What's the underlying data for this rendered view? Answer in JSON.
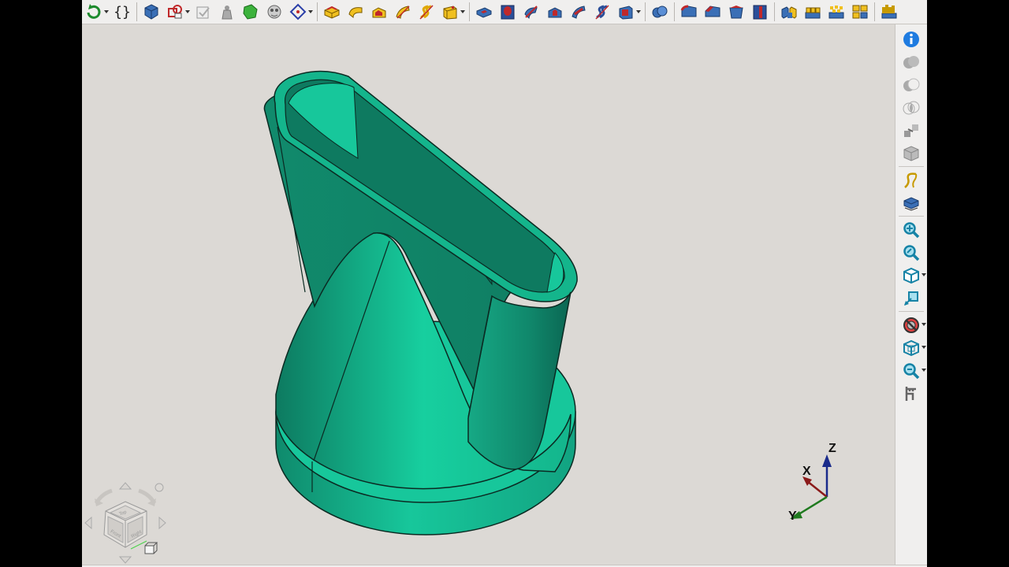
{
  "toolbar": {
    "macro_label": "{}",
    "icons": [
      "refresh-icon",
      "macro-icon",
      "part-icon",
      "sketch-icon",
      "validate-sketch-icon",
      "pad-clone-icon",
      "shape-binder-icon",
      "sub-shape-binder-icon",
      "datum-plane-icon",
      "pad-icon",
      "revolution-icon",
      "additive-loft-icon",
      "additive-pipe-icon",
      "additive-helix-icon",
      "additive-box-icon",
      "pocket-icon",
      "hole-icon",
      "groove-icon",
      "subtractive-loft-icon",
      "subtractive-pipe-icon",
      "subtractive-helix-icon",
      "subtractive-box-icon",
      "boolean-icon",
      "fillet-icon",
      "chamfer-icon",
      "draft-icon",
      "thickness-icon",
      "mirrored-icon",
      "linear-pattern-icon",
      "polar-pattern-icon",
      "multi-transform-icon",
      "sprocket-icon"
    ]
  },
  "right_toolbar": {
    "icons": [
      "info-icon",
      "union-icon",
      "cut-icon",
      "intersection-icon",
      "offset-icon",
      "solid-icon",
      "spline-icon",
      "workbench-icon",
      "fit-all-icon",
      "fit-selection-icon",
      "view-isometric-icon",
      "align-view-icon",
      "clipping-icon",
      "bounding-box-icon",
      "zoom-icon",
      "measure-icon"
    ]
  },
  "nav_cube": {
    "faces": [
      "Front",
      "Right",
      "Top"
    ]
  },
  "axis": {
    "x_label": "X",
    "y_label": "Y",
    "z_label": "Z",
    "x_color": "#8b1a1a",
    "y_color": "#1f7a1f",
    "z_color": "#1a2b8b"
  },
  "model": {
    "color": "#17c79b",
    "shade": "#0f8a6c",
    "edge_color": "#0b2a22"
  }
}
